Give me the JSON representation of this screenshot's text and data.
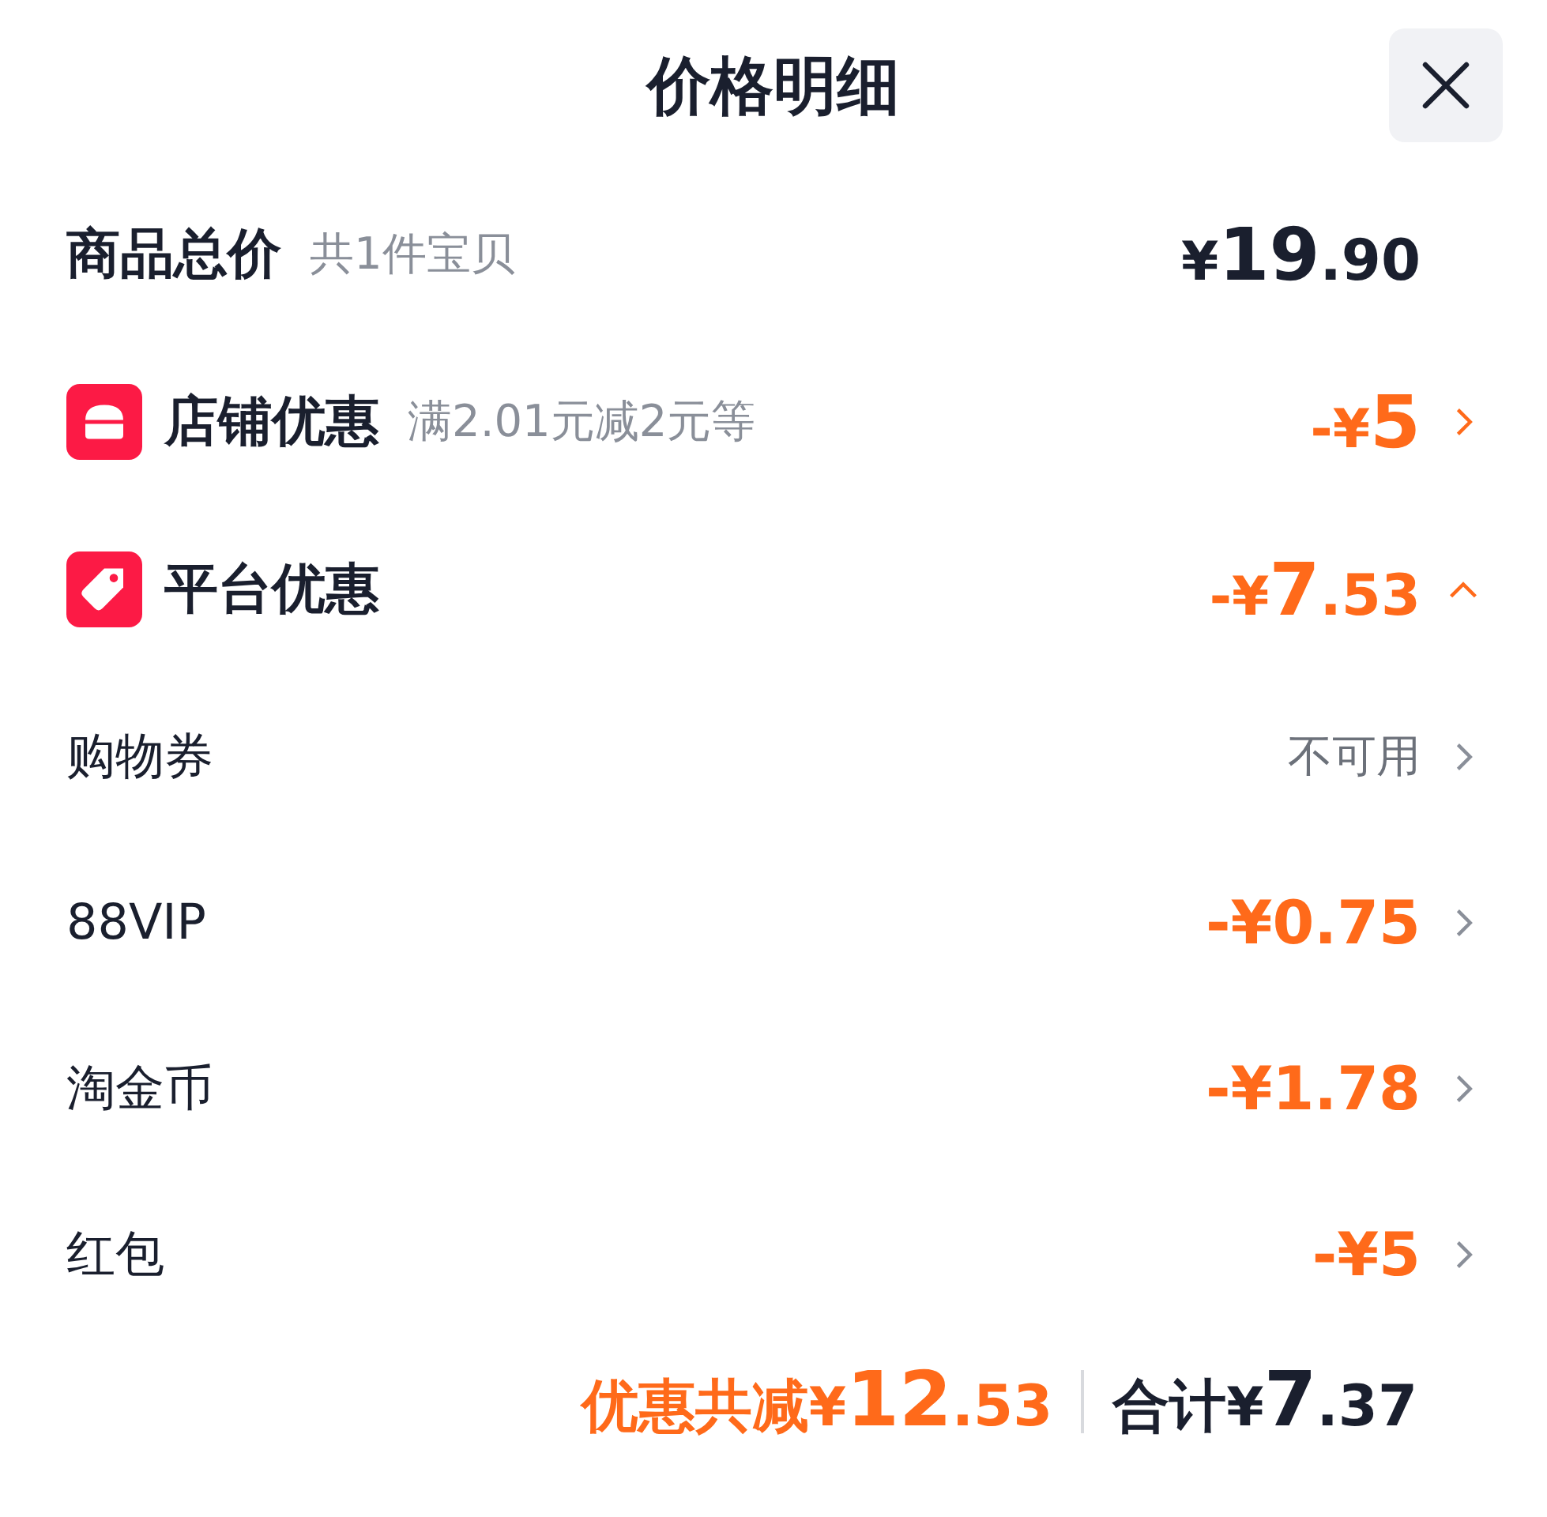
{
  "title": "价格明细",
  "total": {
    "label": "商品总价",
    "note": "共1件宝贝",
    "amount": {
      "currency": "¥",
      "main": "19",
      "fraction": ".90"
    }
  },
  "sections": [
    {
      "kind": "store",
      "label": "店铺优惠",
      "note": "满2.01元减2元等",
      "amount": {
        "sign": "-",
        "currency": "¥",
        "main": "5"
      },
      "expanded": false
    },
    {
      "kind": "tag",
      "label": "平台优惠",
      "amount": {
        "sign": "-",
        "currency": "¥",
        "main": "7",
        "fraction": ".53"
      },
      "expanded": true,
      "items": [
        {
          "label": "购物券",
          "kind": "text",
          "value": "不可用"
        },
        {
          "label": "88VIP",
          "kind": "amount",
          "value": "-¥0.75"
        },
        {
          "label": "淘金币",
          "kind": "amount",
          "value": "-¥1.78"
        },
        {
          "label": "红包",
          "kind": "amount",
          "value": "-¥5"
        }
      ]
    }
  ],
  "footer": {
    "discount": {
      "label": "优惠共减",
      "amount": {
        "currency": "¥",
        "main": "12",
        "fraction": ".53"
      }
    },
    "total": {
      "label": "合计",
      "amount": {
        "currency": "¥",
        "main": "7",
        "fraction": ".37"
      }
    }
  }
}
